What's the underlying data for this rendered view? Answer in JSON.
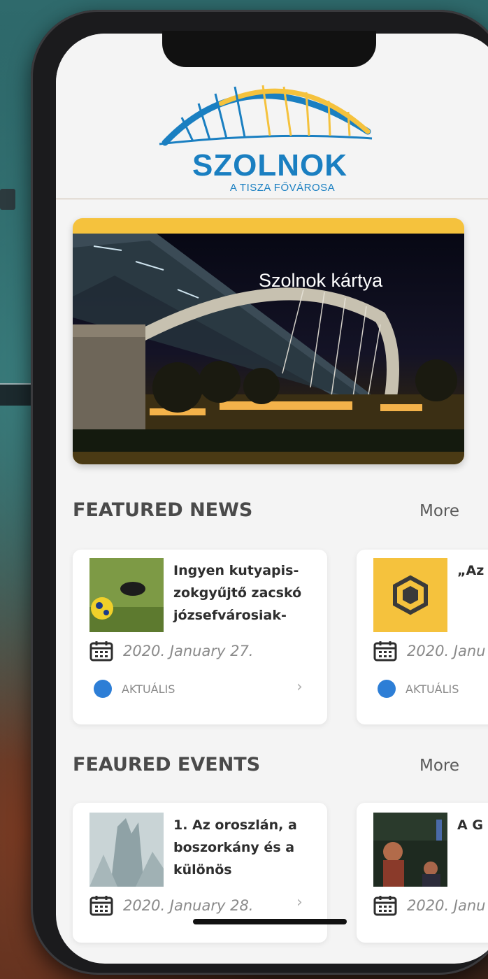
{
  "header": {
    "logo_title": "SZOLNOK",
    "logo_subtitle": "A TISZA FŐVÁROSA"
  },
  "hero": {
    "title": "Szolnok kártya"
  },
  "featured_news": {
    "title": "FEATURED NEWS",
    "more": "More",
    "items": [
      {
        "title": "Ingyen kutyapis-zokgyűjtő zacskó józsefvárosiak-",
        "date": "2020. January 27.",
        "category": "AKTUÁLIS"
      },
      {
        "title": "„Az old der",
        "date": "2020. Janu",
        "category": "AKTUÁLIS"
      }
    ]
  },
  "featured_events": {
    "title": "FEAURED EVENTS",
    "more": "More",
    "items": [
      {
        "title": "1. Az oroszlán, a boszorkány és a különös",
        "date": "2020. January 28."
      },
      {
        "title": "A G - TE",
        "date": "2020. Janu"
      }
    ]
  },
  "colors": {
    "brand_blue": "#1a7fc1",
    "brand_yellow": "#f5c23d",
    "category_dot": "#2d7ed6"
  },
  "icons": {
    "date": "calendar-icon",
    "chevron": "chevron-right-icon"
  }
}
